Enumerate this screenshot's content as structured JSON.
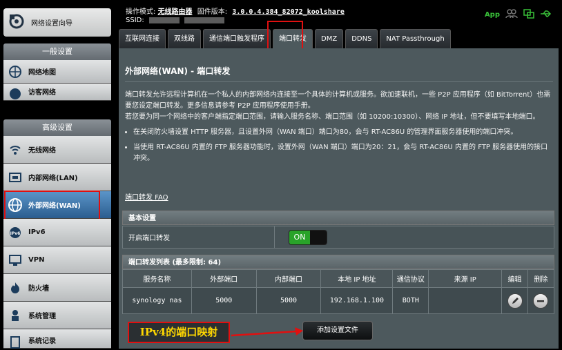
{
  "sidebar": {
    "wizard_label": "网络设置向导",
    "general_head": "一般设置",
    "general_items": [
      "网络地图",
      "访客网络"
    ],
    "advanced_head": "高级设置",
    "advanced_items": [
      "无线网络",
      "内部网络(LAN)",
      "外部网络(WAN)",
      "IPv6",
      "VPN",
      "防火墙",
      "系统管理",
      "系统记录"
    ]
  },
  "top": {
    "mode_label": "操作模式:",
    "mode_value": "无线路由器",
    "firmware_label": "固件版本:",
    "firmware_value": "3.0.0.4.384_82072_koolshare",
    "ssid_label": "SSID:",
    "app_label": "App"
  },
  "tabs": [
    "互联网连接",
    "双线路",
    "通信端口触发程序",
    "端口转发",
    "DMZ",
    "DDNS",
    "NAT Passthrough"
  ],
  "page": {
    "title": "外部网络(WAN) - 端口转发",
    "desc1": "端口转发允许远程计算机在一个私人的内部网络内连接至一个具体的计算机或服务。欲加速联机，一些 P2P 应用程序（如 BitTorrent）也需要您设定端口转发。更多信息请参考 P2P 应用程序使用手册。",
    "desc2": "若您要为同一个网络中的客户端指定端口范围，请输入服务名称、端口范围（如 10200:10300）、网络 IP 地址，但不要填写本地端口。",
    "bullet1": "在关闭防火墙设置 HTTP 服务器，且设置外网（WAN 端口）端口为80，会与 RT-AC86U 的管理界面服务器使用的端口冲突。",
    "bullet2": "当使用 RT-AC86U 内置的 FTP 服务器功能时，设置外网（WAN 端口）端口为20：21，会与 RT-AC86U 内置的 FTP 服务器使用的接口冲突。",
    "faq": "端口转发 FAQ"
  },
  "basic": {
    "head": "基本设置",
    "enable_label": "开启端口转发",
    "toggle_on": "ON"
  },
  "list": {
    "head": "端口转发列表 (最多限制: 64)",
    "columns": [
      "服务名称",
      "外部端口",
      "内部端口",
      "本地 IP 地址",
      "通信协议",
      "来源 IP",
      "编辑",
      "删除"
    ],
    "row": {
      "name": "synology nas",
      "ext": "5000",
      "int": "5000",
      "ip": "192.168.1.100",
      "proto": "BOTH",
      "src": ""
    }
  },
  "add_button": "添加设置文件",
  "annotation": "IPv4的端口映射",
  "colors": {
    "accent": "#4d595d",
    "highlight": "#e01010",
    "annotation_text": "#ffd800",
    "toggle_on": "#29a329"
  }
}
